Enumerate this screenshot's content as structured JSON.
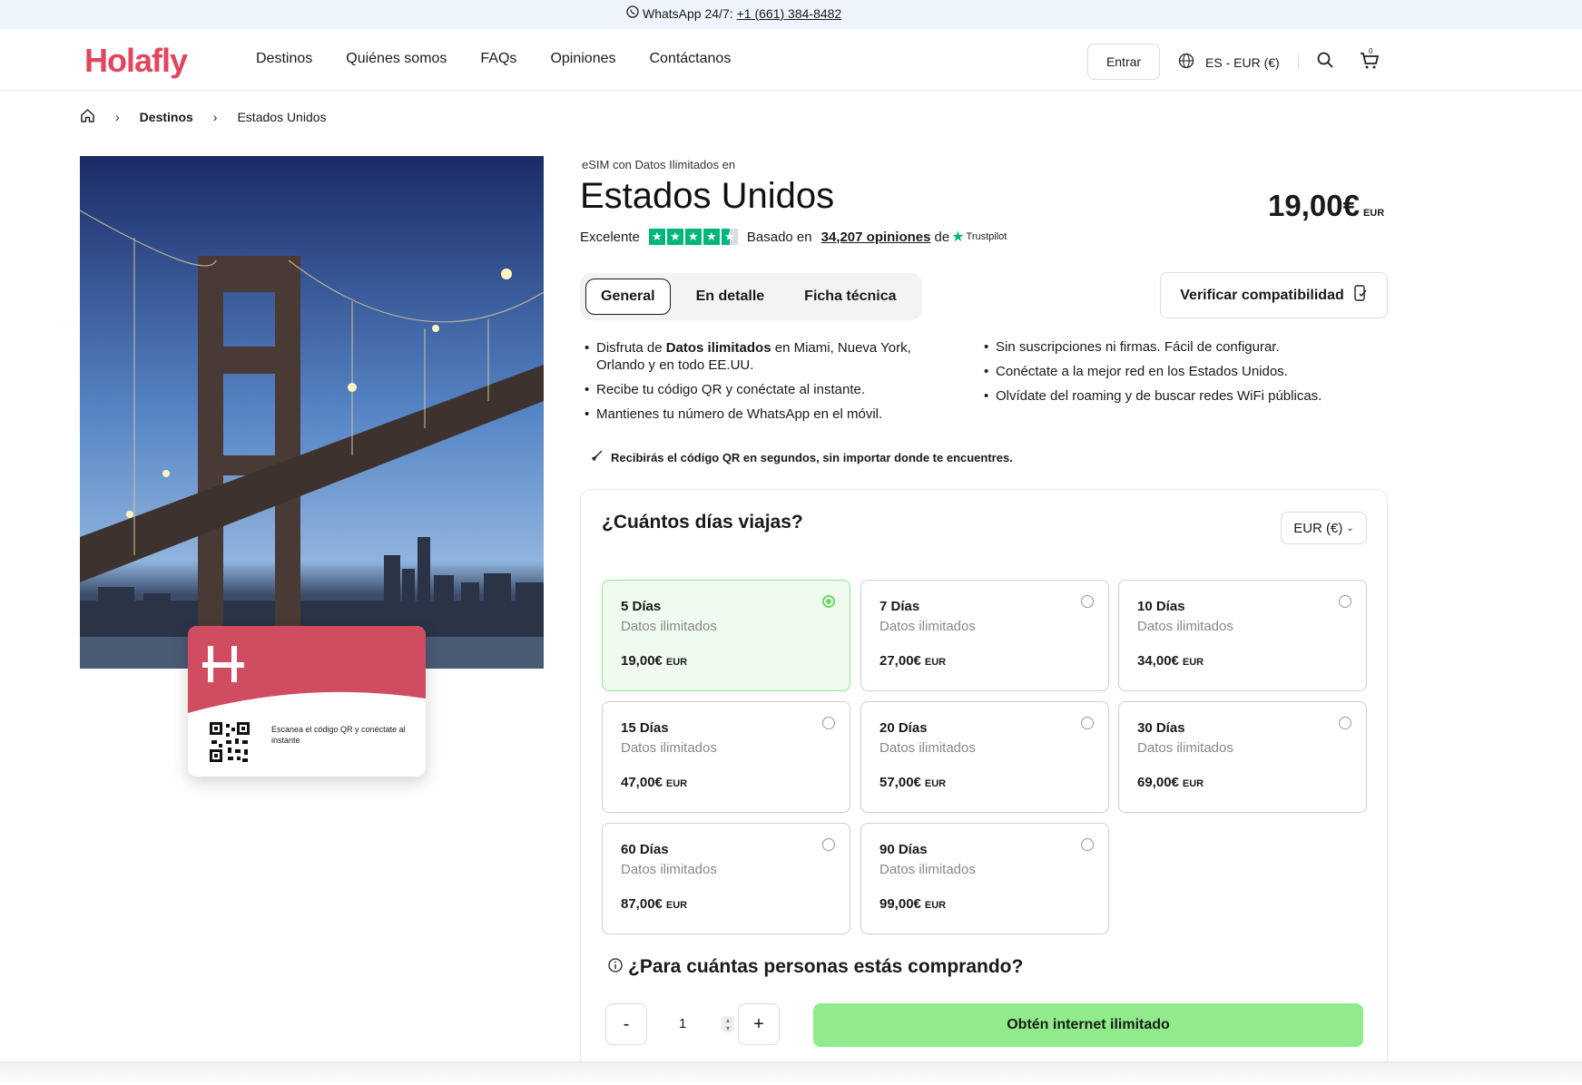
{
  "topbar": {
    "label": "WhatsApp 24/7:",
    "phone": "+1 (661) 384-8482"
  },
  "header": {
    "logo": "Holafly",
    "nav": [
      "Destinos",
      "Quiénes somos",
      "FAQs",
      "Opiniones",
      "Contáctanos"
    ],
    "login": "Entrar",
    "language": "ES - EUR (€)",
    "cart_count": "0"
  },
  "breadcrumb": {
    "level1": "Destinos",
    "level2": "Estados Unidos"
  },
  "hero": {
    "card_caption": "Escanea el código QR y conéctate al instante"
  },
  "product": {
    "subtitle": "eSIM con Datos Ilimitados en",
    "title": "Estados Unidos",
    "price": "19,00€",
    "price_unit": "EUR",
    "rating_word": "Excelente",
    "based_on": "Basado en",
    "review_count": "34,207 opiniones",
    "de": "de",
    "trustpilot": "Trustpilot"
  },
  "tabs": [
    "General",
    "En detalle",
    "Ficha técnica"
  ],
  "verify_button": "Verificar compatibilidad",
  "features_left": [
    [
      "Disfruta de ",
      "Datos ilimitados",
      " en Miami, Nueva York, Orlando y en todo EE.UU."
    ],
    [
      "Recibe tu código QR y conéctate al instante."
    ],
    [
      "Mantienes tu número de WhatsApp en el móvil."
    ]
  ],
  "features_right": [
    "Sin suscripciones ni firmas. Fácil de configurar.",
    "Conéctate a la mejor red en los Estados Unidos.",
    "Olvídate del roaming y de buscar redes WiFi públicas."
  ],
  "notice": "Recibirás el código QR en segundos, sin importar donde te encuentres.",
  "plans_section": {
    "title": "¿Cuántos días viajas?",
    "currency": "EUR (€)",
    "plans": [
      {
        "days": "5 Días",
        "data": "Datos ilimitados",
        "price": "19,00€",
        "unit": "EUR",
        "selected": true
      },
      {
        "days": "7 Días",
        "data": "Datos ilimitados",
        "price": "27,00€",
        "unit": "EUR",
        "selected": false
      },
      {
        "days": "10 Días",
        "data": "Datos ilimitados",
        "price": "34,00€",
        "unit": "EUR",
        "selected": false
      },
      {
        "days": "15 Días",
        "data": "Datos ilimitados",
        "price": "47,00€",
        "unit": "EUR",
        "selected": false
      },
      {
        "days": "20 Días",
        "data": "Datos ilimitados",
        "price": "57,00€",
        "unit": "EUR",
        "selected": false
      },
      {
        "days": "30 Días",
        "data": "Datos ilimitados",
        "price": "69,00€",
        "unit": "EUR",
        "selected": false
      },
      {
        "days": "60 Días",
        "data": "Datos ilimitados",
        "price": "87,00€",
        "unit": "EUR",
        "selected": false
      },
      {
        "days": "90 Días",
        "data": "Datos ilimitados",
        "price": "99,00€",
        "unit": "EUR",
        "selected": false
      }
    ],
    "persons_question": "¿Para cuántas personas estás comprando?",
    "minus": "-",
    "quantity": "1",
    "plus": "+",
    "cta": "Obtén internet ilimitado"
  }
}
